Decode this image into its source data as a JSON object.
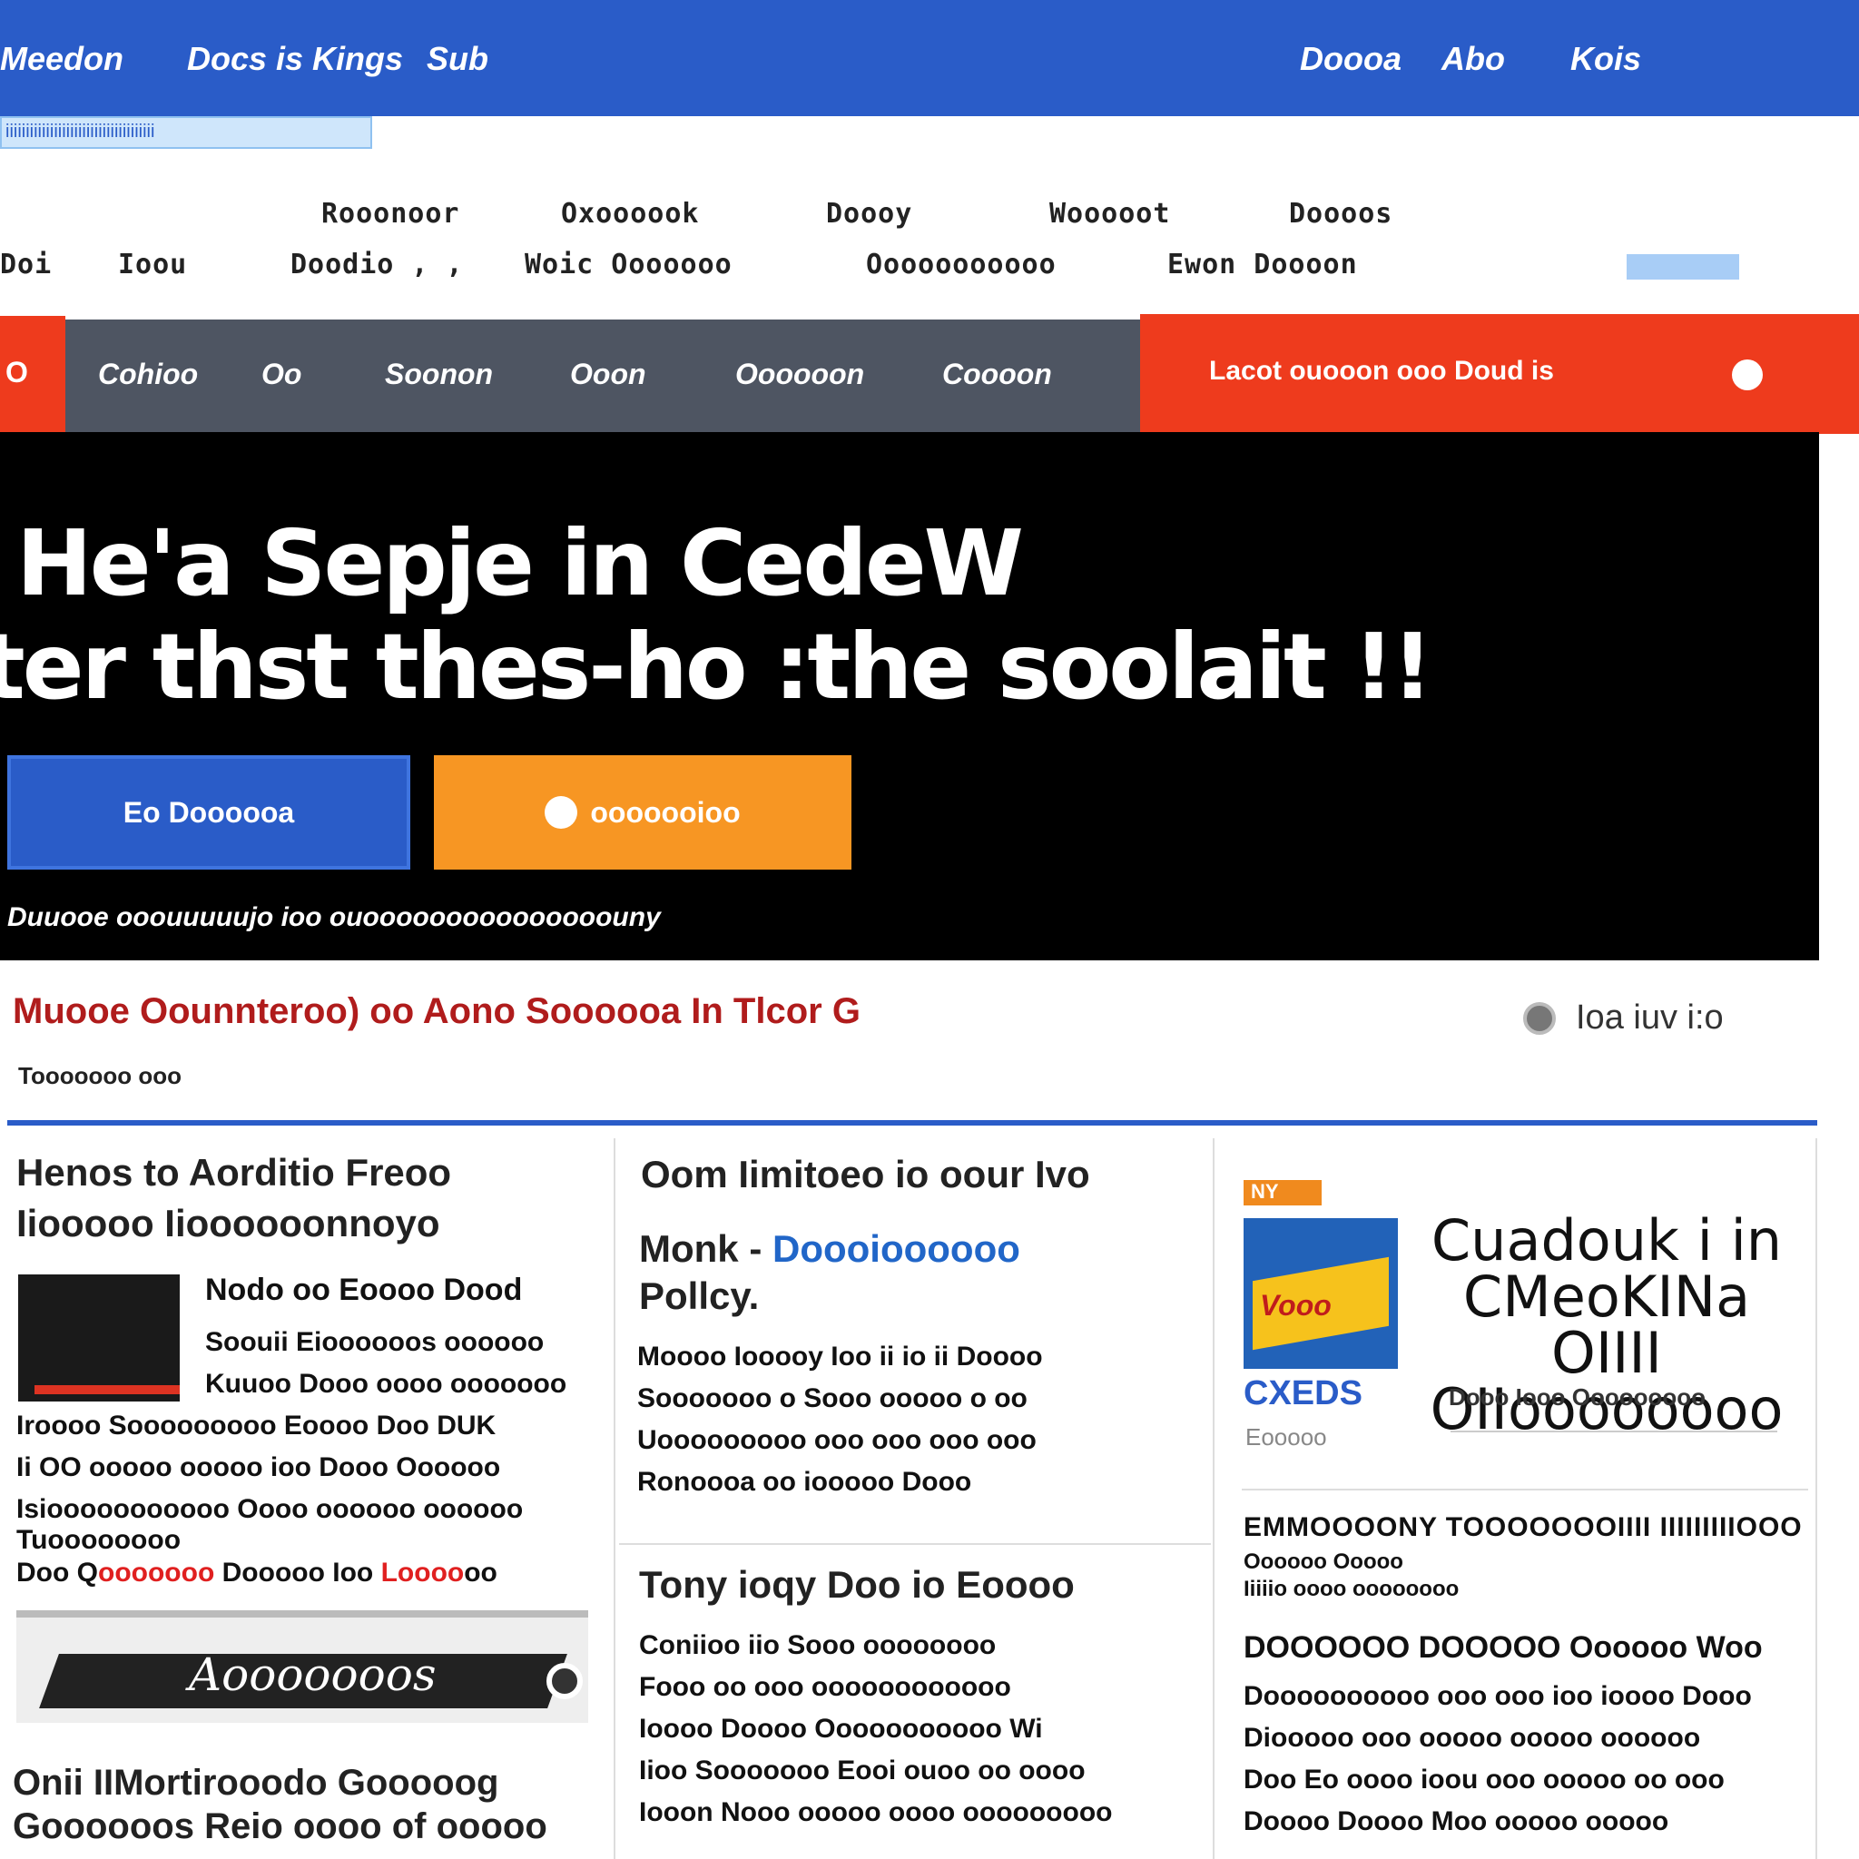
{
  "topbar": {
    "brand": "Meedon",
    "links": [
      "Docs is Kings",
      "Sub"
    ],
    "right_links": [
      "Doooa",
      "Abo",
      "Kois"
    ]
  },
  "strip_text": "iiiiiiiiiiiiiiiiiiiiiiiiiiiiiiiiiiiii",
  "submenu": {
    "row1": [
      "Rooonoor",
      "Oxoooook",
      "Doooy",
      "Wooooot",
      "Doooos"
    ],
    "row2": [
      "Doi",
      "Ioou",
      "Doodio , ,",
      "Woic Ooooooo",
      "Ooooooooooo",
      "Ewon Doooon"
    ]
  },
  "nav": {
    "left_label": "O",
    "items": [
      "Cohioo",
      "Oo",
      "Soonon",
      "Ooon",
      "Oooooon",
      "Coooon"
    ],
    "cta": "Lacot ouooon ooo Doud is"
  },
  "hero": {
    "line1": "He'a Sepje in CedeW",
    "line2": "ter thst thes-ho :the soolait !!",
    "primary_button": "Eo Doooooa",
    "secondary_button": "ooooooioo",
    "note": "Duuooe ooouuuuujo ioo ouooooooooooooooouny"
  },
  "breaking": {
    "text": "Muooe Oounnteroo) oo Aono Soooooa In Tlcor G",
    "time": "Ioa iuv i:o",
    "byline": "Tooooooo ooo"
  },
  "col1": {
    "headline": "Henos to Aorditio Freoo Iiooooo Iioooooonnoyo",
    "story_title": "Nodo oo Eoooo Dood",
    "story_lines": [
      "Soouii Eioooooos oooooo",
      "Kuuoo Dooo oooo ooooooo",
      "Iroooo Sooooooooo Eoooo Doo DUK",
      "Ii OO ooooo ooooo ioo Dooo Oooooo",
      "Isiooooooooooo Oooo oooooo oooooo",
      "Tuoooooooo"
    ],
    "last_line_a": "Doo Q",
    "last_line_red": "ooooooo",
    "last_line_b": "Dooooo Ioo",
    "last_line_red2": "Loooo",
    "last_line_c": "oo",
    "banner_word": "Aooooooos",
    "bottom_headline": "Onii IIMortirooodo Gooooog Goooooos Reio oooo of ooooo"
  },
  "col2": {
    "headline": "Oom Iimitoeo io oour Ivo",
    "sub_a": "Monk -",
    "sub_blue": "Doooioooooo",
    "sub_b": "Pollcy.",
    "lines": [
      "Moooo Iooooy Ioo ii io ii Doooo",
      "Sooooooo o Sooo ooooo o oo",
      "Uooooooooo ooo ooo ooo ooo",
      "Ronoooa oo iooooo Dooo"
    ],
    "headline2": "Tony ioqy Doo io Eoooo",
    "lines2": [
      "Coniioo iio Sooo oooooooo",
      "Fooo oo ooo oooooooooooo",
      "Ioooo Doooo Ooooooooooo Wi",
      "Iioo Sooooooo Eooi ouoo oo oooo",
      "Iooon Nooo ooooo oooo ooooooooo"
    ]
  },
  "col3": {
    "tag": "NY",
    "mag_text": "Vooo",
    "mag_brand": "CXEDS",
    "mag_small": "Eooooo",
    "title": "Cuadouk i in CMeoKINa OIIII OIIoooooooo",
    "sub": "Dooo Iooo Ooooooooo",
    "section": "EMMOOOONY TOOOOOOOIIII IIIIIIIIIOOO",
    "section_sub1": "Oooooo Ooooo",
    "section_sub2": "Iiiiio oooo oooooooo",
    "headline": "DOOOOOO DOOOOO Oooooo Woo",
    "lines": [
      "Doooooooooo ooo ooo ioo ioooo Dooo",
      "Diooooo ooo ooooo ooooo oooooo",
      "Doo Eo oooo ioou ooo ooooo oo ooo",
      "Doooo Doooo Moo ooooo ooooo"
    ]
  },
  "colors": {
    "primary_blue": "#2a5cc8",
    "nav_gray": "#4e5562",
    "accent_red": "#ee3b1d",
    "accent_orange": "#f79623",
    "hero_bg": "#000000"
  }
}
